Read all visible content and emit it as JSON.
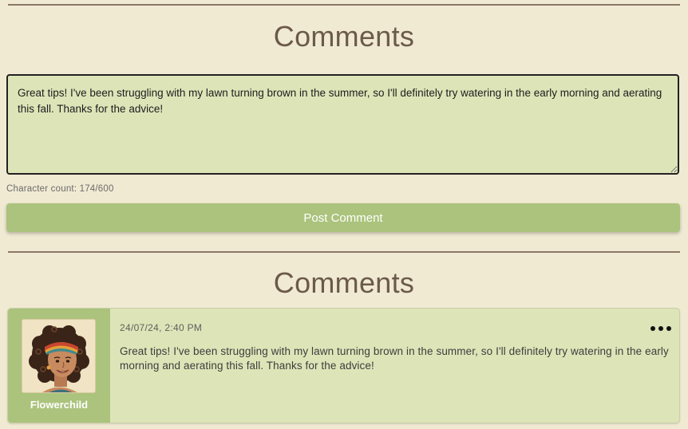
{
  "composer": {
    "title": "Comments",
    "textarea_value": "Great tips! I've been struggling with my lawn turning brown in the summer, so I'll definitely try watering in the early morning and aerating this fall. Thanks for the advice!",
    "char_count_label": "Character count: 174/600",
    "post_button_label": "Post Comment"
  },
  "list": {
    "title": "Comments",
    "comments": [
      {
        "username": "Flowerchild",
        "avatar_icon": "avatar-illustration-woman-curly-hair-headband",
        "date": "24/07/24, 2:40 PM",
        "text": "Great tips! I've been struggling with my lawn turning brown in the summer, so I'll definitely try watering in the early morning and aerating this fall. Thanks for the advice!",
        "menu_icon": "more-options-icon"
      }
    ]
  },
  "colors": {
    "background": "#f1ead3",
    "accent": "#abc37c",
    "card": "#dde5b8",
    "title": "#6b5a49",
    "divider": "#8a7866"
  }
}
